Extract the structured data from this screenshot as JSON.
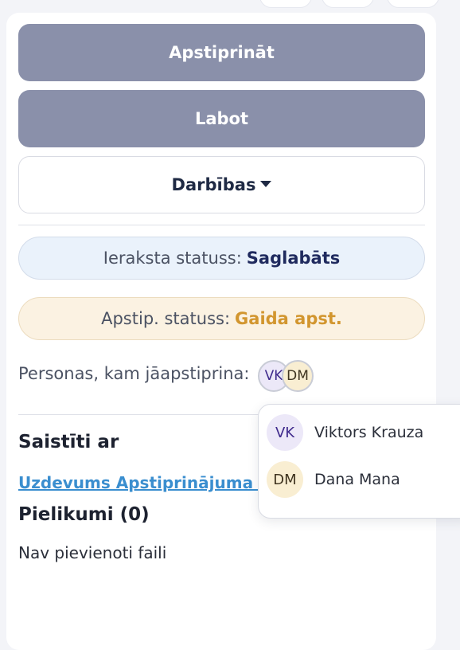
{
  "actions": {
    "approve_label": "Apstiprināt",
    "edit_label": "Labot",
    "actions_label": "Darbības"
  },
  "record_status": {
    "label": "Ieraksta statuss:",
    "value": "Saglabāts"
  },
  "approval_status": {
    "label": "Apstip. statuss:",
    "value": "Gaida apst."
  },
  "approvers": {
    "label": "Personas, kam jāapstiprina:",
    "people": [
      {
        "initials": "VK",
        "name": "Viktors Krauza"
      },
      {
        "initials": "DM",
        "name": "Dana Mana"
      }
    ]
  },
  "related": {
    "title": "Saistīti ar",
    "link_text": "Uzdevums Apstiprinājuma p"
  },
  "attachments": {
    "title": "Pielikumi (0)",
    "empty_text": "Nav pievienoti faili"
  },
  "colors": {
    "primary_button": "#8a90aa",
    "status_saved": "#1f2a5e",
    "status_pending": "#d2962f",
    "link": "#3a8ecf"
  }
}
